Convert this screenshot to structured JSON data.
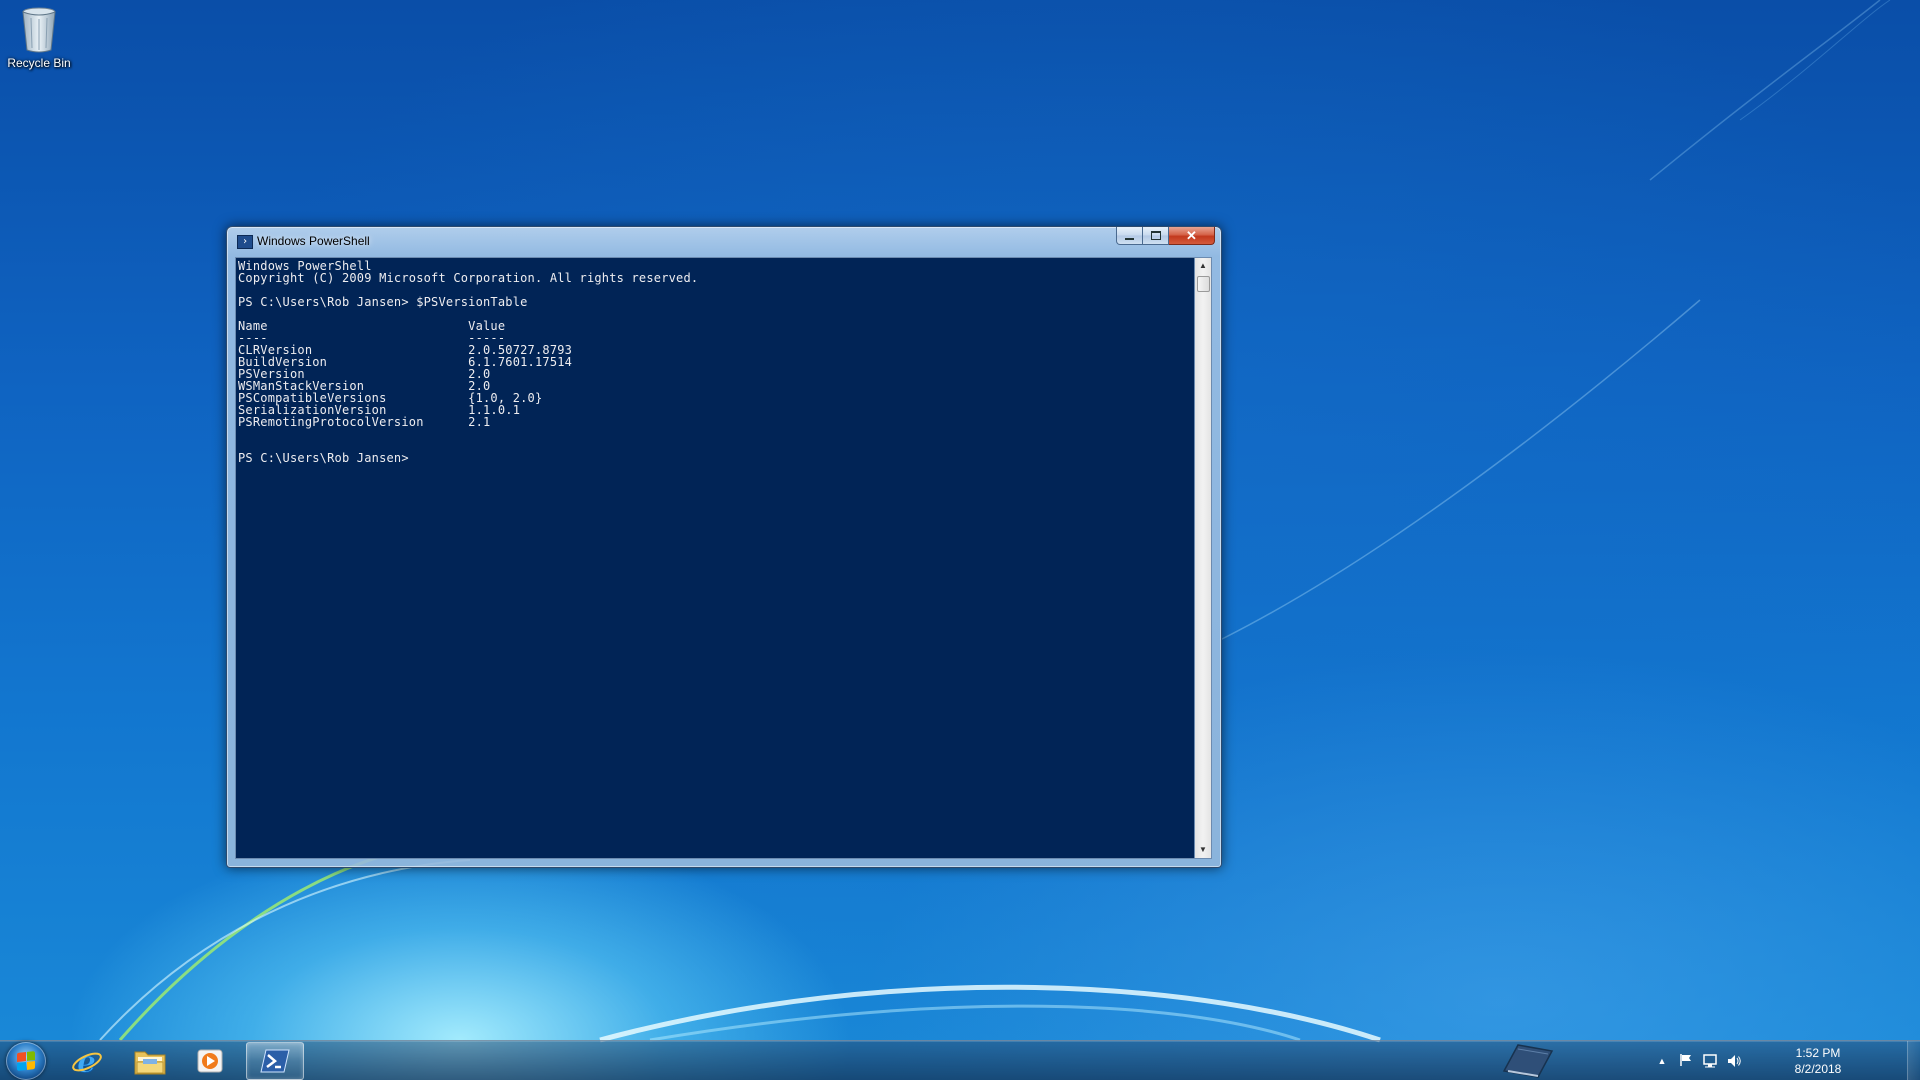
{
  "desktop": {
    "icons": [
      {
        "label": "Recycle Bin",
        "icon": "recycle-bin-icon"
      }
    ]
  },
  "window": {
    "title": "Windows PowerShell",
    "icon": "powershell-icon",
    "buttons": {
      "minimize": "minimize-icon",
      "maximize": "maximize-icon",
      "close": "close-icon"
    }
  },
  "console": {
    "background": "#012456",
    "foreground": "#eeedf0",
    "text": "Windows PowerShell\nCopyright (C) 2009 Microsoft Corporation. All rights reserved.\n\nPS C:\\Users\\Rob Jansen> $PSVersionTable\n\nName                           Value\n----                           -----\nCLRVersion                     2.0.50727.8793\nBuildVersion                   6.1.7601.17514\nPSVersion                      2.0\nWSManStackVersion              2.0\nPSCompatibleVersions           {1.0, 2.0}\nSerializationVersion           1.1.0.1\nPSRemotingProtocolVersion      2.1\n\n\nPS C:\\Users\\Rob Jansen>"
  },
  "taskbar": {
    "start_icon": "windows-start-icon",
    "pinned": [
      {
        "name": "Internet Explorer",
        "icon": "internet-explorer-icon"
      },
      {
        "name": "Windows Explorer",
        "icon": "folder-icon"
      },
      {
        "name": "Windows Media Player",
        "icon": "media-player-icon"
      },
      {
        "name": "Windows PowerShell",
        "icon": "powershell-icon",
        "active": true
      }
    ],
    "tray": {
      "icons": [
        "show-hidden-icons-arrow-icon",
        "action-center-flag-icon",
        "network-icon",
        "volume-icon"
      ],
      "time": "1:52 PM",
      "date": "8/2/2018"
    }
  }
}
